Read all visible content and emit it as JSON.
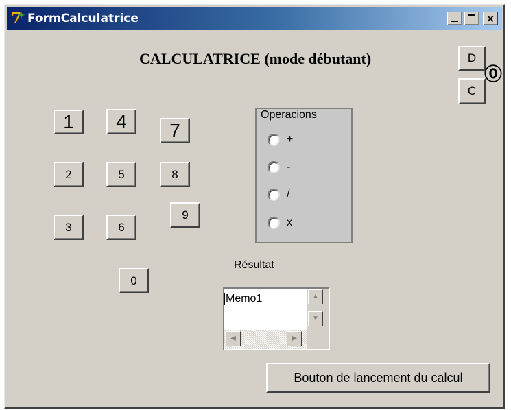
{
  "window": {
    "title": "FormCalculatrice",
    "close_glyph": "×"
  },
  "heading": "CALCULATRICE (mode débutant)",
  "top_buttons": {
    "d_label": "D",
    "c_label": "C"
  },
  "marker_label": "⓪",
  "digits": {
    "one": "1",
    "two": "2",
    "three": "3",
    "four": "4",
    "five": "5",
    "six": "6",
    "seven": "7",
    "eight": "8",
    "nine": "9",
    "zero": "0"
  },
  "operations": {
    "legend": "Operacions",
    "items": [
      {
        "label": "+",
        "selected": false
      },
      {
        "label": "-",
        "selected": false
      },
      {
        "label": "/",
        "selected": false
      },
      {
        "label": "x",
        "selected": false
      }
    ]
  },
  "result": {
    "label": "Résultat",
    "memo_value": "Memo1"
  },
  "calc_button_label": "Bouton de lancement du calcul",
  "icons": {
    "app": "delphi-app-icon",
    "scroll_up": "scroll-up-arrow-icon",
    "scroll_down": "scroll-down-arrow-icon",
    "scroll_left": "scroll-left-arrow-icon",
    "scroll_right": "scroll-right-arrow-icon"
  },
  "colors": {
    "titlebar_start": "#0a246a",
    "titlebar_end": "#a6caf0",
    "face": "#d4d0c8",
    "groupbox": "#c8c8c8"
  }
}
